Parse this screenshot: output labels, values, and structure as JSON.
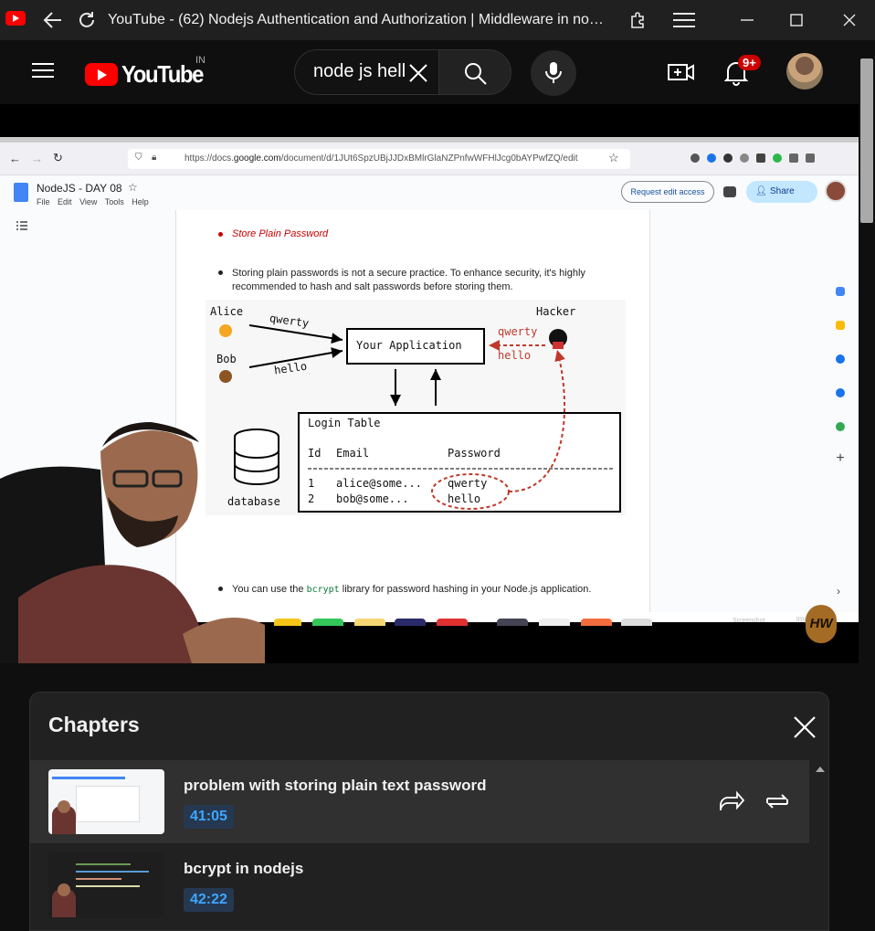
{
  "window": {
    "title": "YouTube - (62) Nodejs Authentication and Authorization | Middleware in node..."
  },
  "header": {
    "logo_text": "YouTube",
    "country": "IN",
    "search_value": "node js hell",
    "notification_count": "9+"
  },
  "video": {
    "browser": {
      "url_prefix": "https://docs.",
      "url_domain": "google.com",
      "url_rest": "/document/d/1JUt6SpzUBjJJDxBMlrGlaNZPnfwWFHlJcg0bAYPwfZQ/edit"
    },
    "gdoc": {
      "title": "NodeJS - DAY 08",
      "menu": [
        "File",
        "Edit",
        "View",
        "Tools",
        "Help"
      ],
      "request_edit": "Request edit access",
      "share": "Share",
      "bullet1": "Store Plain Password",
      "bullet2": "Storing plain passwords is not a secure practice. To enhance security, it's highly recommended to hash and salt passwords before storing them.",
      "bullet3_pre": "You can use the ",
      "bullet3_code": "bcrypt",
      "bullet3_post": " library for password hashing in your Node.js application."
    },
    "diagram": {
      "alice": "Alice",
      "bob": "Bob",
      "hacker": "Hacker",
      "alice_pw": "qwerty",
      "bob_pw": "hello",
      "hacker_pw1": "qwerty",
      "hacker_pw2": "hello",
      "app": "Your Application",
      "db": "database",
      "table_title": "Login Table",
      "col_id": "Id",
      "col_email": "Email",
      "col_password": "Password",
      "row1_id": "1",
      "row1_email": "alice@some...",
      "row1_pw": "qwerty",
      "row2_id": "2",
      "row2_email": "bob@some...",
      "row2_pw": "hello"
    },
    "badge": "HW",
    "dock_labels": [
      "Screenshot",
      "imp Nodejs-"
    ]
  },
  "chapters": {
    "heading": "Chapters",
    "items": [
      {
        "title": "problem with storing plain text password",
        "time": "41:05"
      },
      {
        "title": "bcrypt in nodejs",
        "time": "42:22"
      }
    ]
  },
  "colors": {
    "accent_red": "#ff0000",
    "time_blue": "#3ea6ff",
    "diagram_red": "#c0392b"
  }
}
